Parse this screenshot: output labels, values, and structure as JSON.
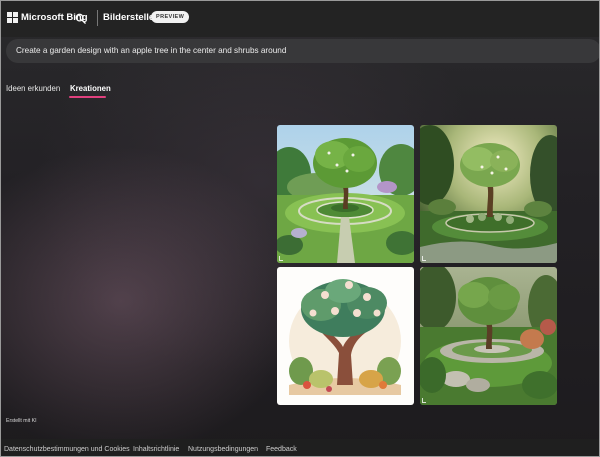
{
  "header": {
    "brand": "Microsoft Bing",
    "app_title": "Bildersteller",
    "badge": "PREVIEW",
    "search_icon": "search-icon",
    "logo_icon": "microsoft-logo-icon"
  },
  "prompt": {
    "text": "Create a garden design with an apple tree in the center and shrubs around"
  },
  "tabs": [
    {
      "label": "Ideen erkunden",
      "active": false
    },
    {
      "label": "Kreationen",
      "active": true
    }
  ],
  "accent_color": "#e0407e",
  "images": [
    {
      "alt": "Generated garden image 1"
    },
    {
      "alt": "Generated garden image 2"
    },
    {
      "alt": "Generated garden image 3"
    },
    {
      "alt": "Generated garden image 4"
    }
  ],
  "created_label": "Erstellt mit KI",
  "footer": {
    "links": [
      "Datenschutzbestimmungen und Cookies",
      "Inhaltsrichtlinie",
      "Nutzungsbedingungen",
      "Feedback"
    ]
  }
}
